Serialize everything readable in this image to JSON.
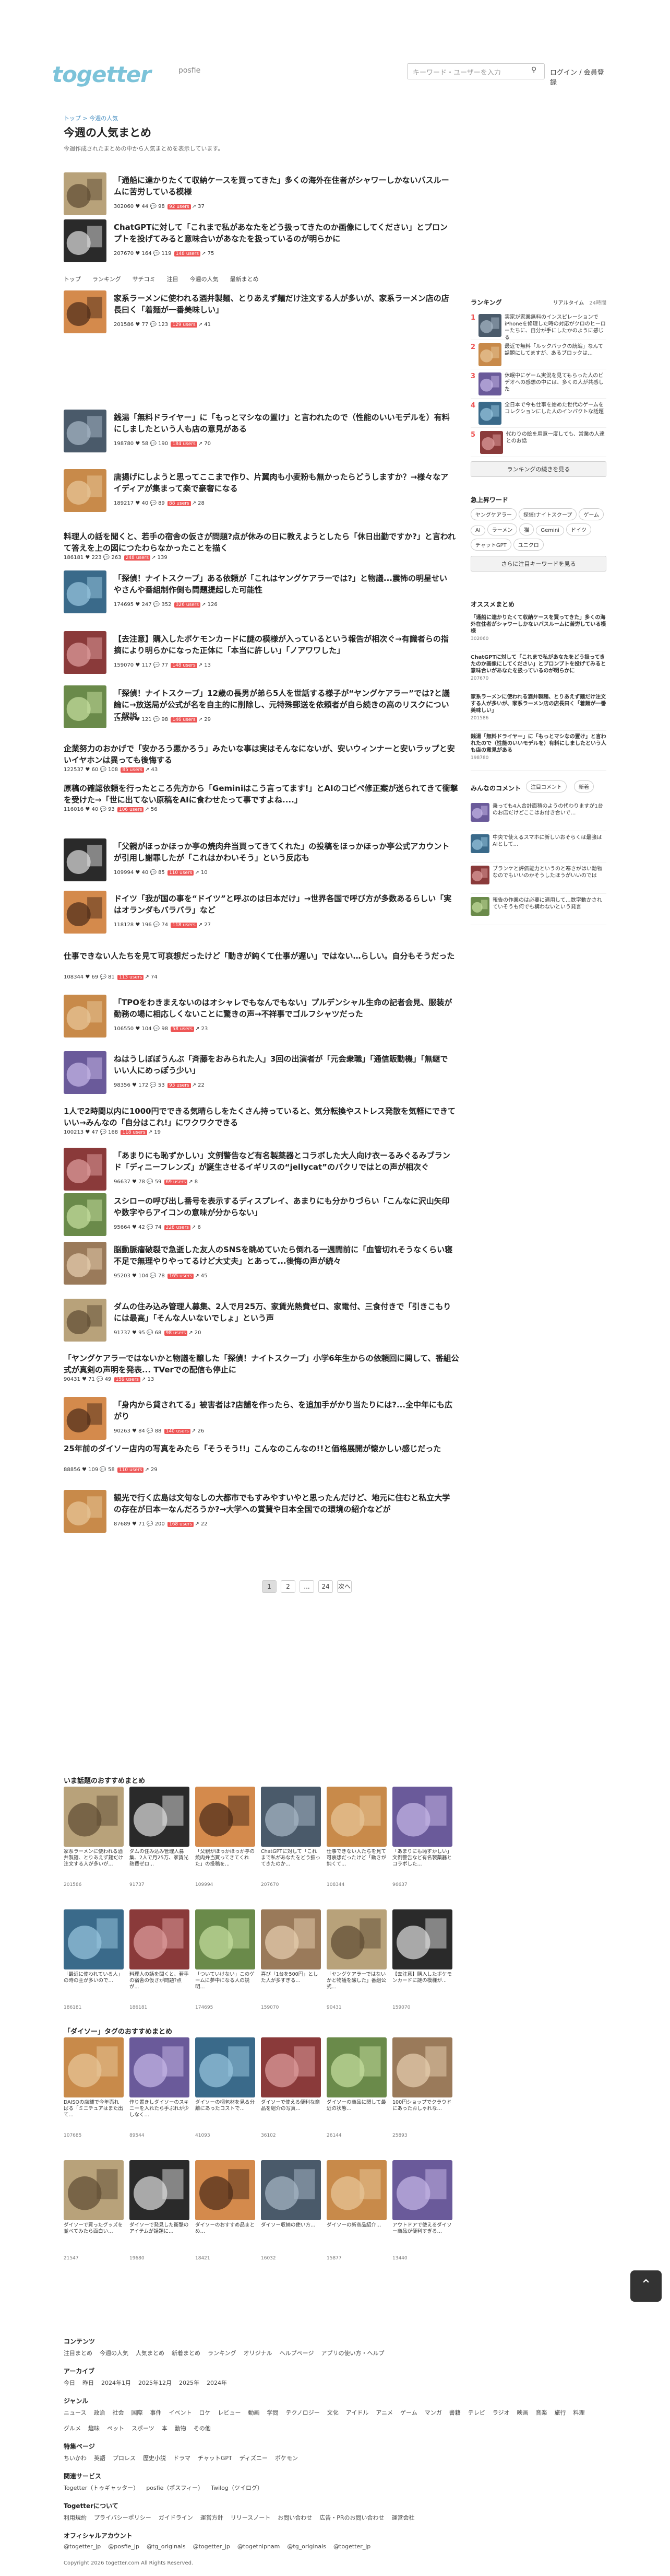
{
  "header": {
    "logo": "togetter",
    "sub": "posfie",
    "search_placeholder": "キーワード・ユーザーを入力",
    "login": "ログイン / 会員登録"
  },
  "breadcrumb": "トップ > 今週の人気",
  "page": {
    "title": "今週の人気まとめ",
    "desc": "今週作成されたまとめの中から人気まとめを表示しています。"
  },
  "subnav": [
    "トップ",
    "ランキング",
    "サチコミ",
    "注目",
    "今週の人気",
    "最新まとめ"
  ],
  "items": [
    {
      "title": "「通船に達かりたくて収納ケースを買ってきた」多くの海外在住者がシャワーしかないバスルームに苦労している模様",
      "views": "302060",
      "fav": "44",
      "comments": "98",
      "tag": "92 users",
      "share": "37"
    },
    {
      "title": "ChatGPTに対して「これまで私があなたをどう扱ってきたのか画像にしてください」とプロンプトを投げてみると意味合いがあなたを扱っているのが明らかに",
      "views": "207670",
      "fav": "164",
      "comments": "119",
      "tag": "148 users",
      "share": "75"
    },
    {
      "title": "家系ラーメンに使われる酒井製麺、とりあえず麺だけ注文する人が多いが、家系ラーメン店の店長曰く「着麺が一番美味しい」",
      "views": "201586",
      "fav": "77",
      "comments": "123",
      "tag": "129 users",
      "share": "41"
    },
    {
      "title": "銭湯「無料ドライヤー」に「もっとマシなの置け」と言われたので（性能のいいモデルを）有料にしましたという人も店の意見がある",
      "views": "198780",
      "fav": "58",
      "comments": "190",
      "tag": "184 users",
      "share": "70"
    },
    {
      "title": "唐揚げにしようと思ってここまで作り、片翼肉も小麦粉も無かったらどうしますか？→様々なアイディアが集まって楽で豪奢になる",
      "views": "189217",
      "fav": "40",
      "comments": "89",
      "tag": "88 users",
      "share": "28"
    },
    {
      "title": "料理人の話を聞くと、若手の宿舎の仮さが問題?点が休みの日に教えようとしたら「休日出勤ですか?」と言われて答えを上の図につたわらなかったことを描く",
      "views": "186181",
      "fav": "223",
      "comments": "263",
      "tag": "248 users",
      "share": "139"
    },
    {
      "title": "「探偵！ナイトスクープ」ある依頼が「これはヤングケアラーでは?」と物議...震怖の明星せいやさんや番組制作側も問題提起した可能性",
      "views": "174695",
      "fav": "247",
      "comments": "352",
      "tag": "326 users",
      "share": "126"
    },
    {
      "title": "【去注意】購入したポケモンカードに謎の模様が入っているという報告が相次ぐ→有識者らの指摘により明らかになった正体に「本当に許しい」「ノアワワした」",
      "views": "159070",
      "fav": "117",
      "comments": "77",
      "tag": "148 users",
      "share": "13"
    },
    {
      "title": "「探偵！ナイトスクープ」12歳の長男が弟ら5人を世話する様子が“ヤングケアラー”では?と議論に→放送局が公式が名を自主的に削除し、元特殊郵送を依頼者が自ら続きの高のリスクについて解説",
      "views": "132570",
      "fav": "121",
      "comments": "98",
      "tag": "146 users",
      "share": "29"
    },
    {
      "title": "企業努力のおかげで「安かろう悪かろう」みたいな事は実はそんなにないが、安いウィンナーと安いラップと安いイヤホンは異っても後悔する",
      "views": "122537",
      "fav": "60",
      "comments": "108",
      "tag": "85 users",
      "share": "43"
    },
    {
      "title": "原稿の確認依頼を行ったところ先方から「Geminiはこう言ってます!」とAIのコピペ修正案が送られてきて衝撃を受けた→「世に出てない原稿をAIに食わせたって事ですよね....」",
      "views": "116016",
      "fav": "40",
      "comments": "93",
      "tag": "106 users",
      "share": "56"
    },
    {
      "title": "「父親がほっかほっか亭の焼肉弁当買ってきてくれた」の投稿をほっかほっか亭公式アカウントが引用し謝罪したが「これはかわいそう」という反応も",
      "views": "109994",
      "fav": "40",
      "comments": "85",
      "tag": "110 users",
      "share": "10"
    },
    {
      "title": "ドイツ「我が国の事を“ドイツ”と呼ぶのは日本だけ」→世界各国で呼び方が多数あるらしい「実はオランダもバラバラ」など",
      "views": "118128",
      "fav": "196",
      "comments": "74",
      "tag": "118 users",
      "share": "27"
    },
    {
      "title": "仕事できない人たちを見て可哀想だったけど「動きが鈍くて仕事が遅い」ではない…らしい。自分もそうだった",
      "views": "108344",
      "fav": "69",
      "comments": "81",
      "tag": "113 users",
      "share": "74"
    },
    {
      "title": "「TPOをわきまえないのはオシャレでもなんでもない」プルデンシャル生命の記者会見、服装が勤務の場に相応しくないことに驚きの声→不祥事でゴルフシャツだった",
      "views": "106550",
      "fav": "104",
      "comments": "98",
      "tag": "58 users",
      "share": "23"
    },
    {
      "title": "ねはうしぼぼうんぶ「斉藤をおみられた人」3回の出演者が「元会衆職」「通信販動機」「無継でいい人にめっぽう少い」",
      "views": "98356",
      "fav": "172",
      "comments": "53",
      "tag": "93 users",
      "share": "22"
    },
    {
      "title": "1人で2時間以内に1000円でできる気晴らしをたくさん持っていると、気分転換やストレス発散を気軽にできていい→みんなの「自分はこれ!」にワクワクできる",
      "views": "100213",
      "fav": "47",
      "comments": "168",
      "tag": "118 users",
      "share": "19"
    },
    {
      "title": "「あまりにも恥ずかしい」文例警告など有名製薬器とコラボした大人向け衣ーるみぐるみブランド「ディニーフレンズ」が誕生させるイギリスの“jellycat”のパクリではとの声が相次ぐ",
      "views": "96637",
      "fav": "78",
      "comments": "59",
      "tag": "69 users",
      "share": "8"
    },
    {
      "title": "スシローの呼び出し番号を表示するディスプレイ、あまりにも分かりづらい「こんなに沢山矢印や数字やらアイコンの意味が分からない」",
      "views": "95664",
      "fav": "42",
      "comments": "74",
      "tag": "228 users",
      "share": "6"
    },
    {
      "title": "脳動脈瘤破裂で急逝した友人のSNSを眺めていたら倒れる一週間前に「血管切れそうなくらい寝不足で無理やりやってるけど大丈夫」とあって...後悔の声が続々",
      "views": "95203",
      "fav": "104",
      "comments": "78",
      "tag": "165 users",
      "share": "45"
    },
    {
      "title": "ダムの住み込み管理人募集、2人で月25万、家賃光熱費ゼロ、家電付、三食付きで「引きこもりには最高」「そんな人いないでしょ」という声",
      "views": "91737",
      "fav": "95",
      "comments": "68",
      "tag": "98 users",
      "share": "20"
    },
    {
      "title": "「ヤングケアラーではないかと物議を醸した「探偵！ナイトスクープ」小学6年生からの依頼回に関して、番組公式が真剣の声明を発表... TVerでの配信も停止に",
      "views": "90431",
      "fav": "71",
      "comments": "49",
      "tag": "159 users",
      "share": "13"
    },
    {
      "title": "「身内から貸されてる」被害者は?店舗を作ったら、を追加手がかり当たりには?...全中年にも広がり",
      "views": "90263",
      "fav": "84",
      "comments": "88",
      "tag": "140 users",
      "share": "26"
    },
    {
      "title": "25年前のダイソー店内の写真をみたら「そうそう!!」こんなのこんなの!!と価格展開が懐かしい感じだった",
      "views": "88856",
      "fav": "109",
      "comments": "58",
      "tag": "110 users",
      "share": "29"
    },
    {
      "title": "観光で行く広島は文句なしの大都市でもすみやすいやと思ったんだけど、地元に住むと私立大学の存在が日本一なんだろうか?→大学への賞賛や日本全国での環境の紹介などが",
      "views": "87689",
      "fav": "71",
      "comments": "200",
      "tag": "168 users",
      "share": "22"
    }
  ],
  "pager": [
    "1",
    "2",
    "...",
    "24",
    "次へ"
  ],
  "sidebar": {
    "ranking_title": "ランキング",
    "rank_tabs": [
      "リアルタイム",
      "24時間"
    ],
    "ranking": [
      {
        "t": "実家が家業無料のインスピレーションでiPhoneを修理した時の対応がクロのヒーローたちに、自分が手にしたかのように感じる"
      },
      {
        "t": "最近で無料「ルックバックの続編」なんて話題にしてますが、あるブロックは…"
      },
      {
        "t": "休眠中にゲーム実況を見てもらった人のビデオへの感想の中には、多くの人が共感した"
      },
      {
        "t": "全日本で今も仕事を始めた世代のゲームをコレクションにした人のインパクトな話題"
      },
      {
        "t": "代わりの絵を用意一度しても、営業の人達とのお話"
      }
    ],
    "ranking_more": "ランキングの続きを見る",
    "trend_title": "急上昇ワード",
    "trend": [
      "ヤングケアラー",
      "探偵!ナイトスクープ",
      "ゲーム",
      "AI",
      "ラーメン",
      "猫",
      "Gemini",
      "ドイツ",
      "チャットGPT",
      "ユニクロ"
    ],
    "trend_more": "さらに注目キーワードを見る",
    "rec_title": "オススメまとめ",
    "rec": [
      {
        "t": "「通船に達かりたくて収納ケースを買ってきた」多くの海外在住者がシャワーしかないバスルームに苦労している模様",
        "m": "302060"
      },
      {
        "t": "ChatGPTに対して「これまで私があなたをどう扱ってきたのか画像にしてください」とプロンプトを投げてみると意味合いがあなたを扱っているのが明らかに",
        "m": "207670"
      },
      {
        "t": "家系ラーメンに使われる酒井製麺、とりあえず麺だけ注文する人が多いが、家系ラーメン店の店長曰く「着麺が一番美味しい」",
        "m": "201586"
      },
      {
        "t": "銭湯「無料ドライヤー」に「もっとマシなの置け」と言われたので（性能のいいモデルを）有料にしましたという人も店の意見がある",
        "m": "198780"
      }
    ],
    "comm_title": "みんなのコメント",
    "comm_tabs": [
      "注目コメント",
      "新着"
    ],
    "comments": [
      {
        "t": "乗っても4人合計面積のようの代わりますが1台のお店だけどここはお付き合いで…"
      },
      {
        "t": "中央で使えるスマホに新しいおそらくは最強はAIとして…"
      },
      {
        "t": "ブランケと評価能力というのと寒さがはい動物なのでもいいのかそうしたほうがいいのでは"
      },
      {
        "t": "報告の作業のは必要に適用して…数字動かされていそうも何でも構わないという発言"
      }
    ]
  },
  "recommend1": {
    "title": "いま話題のおすすめまとめ"
  },
  "recommend2": {
    "title": "「ダイソー」タグのおすすめまとめ"
  },
  "cards1": [
    {
      "t": "家系ラーメンに使われる酒井製麺、とりあえず麺だけ注文する人が多いが...",
      "m": "201586"
    },
    {
      "t": "ダムの住み込み管理人募集、2人で月25万、家賃光熱費ゼロ...",
      "m": "91737"
    },
    {
      "t": "「父親がほっかほっか亭の焼肉弁当買ってきてくれた」の投稿を...",
      "m": "109994"
    },
    {
      "t": "ChatGPTに対して「これまで私があなたをどう扱ってきたのか...",
      "m": "207670"
    },
    {
      "t": "仕事できない人たちを見て可哀想だったけど「動きが鈍くて...",
      "m": "108344"
    },
    {
      "t": "「あまりにも恥ずかしい」文例警告など有名製薬器とコラボした...",
      "m": "96637"
    },
    {
      "t": "「最近に使われている人」の時の主が多いので…",
      "m": "186181"
    },
    {
      "t": "料理人の話を聞くと、若手の宿舎の仮さが問題?点が...",
      "m": "186181"
    },
    {
      "t": "「ついていけない」このゲームに夢中になる人の説明...",
      "m": "174695"
    },
    {
      "t": "喜び「1台を500円」とした人が多すぎる...",
      "m": "159070"
    },
    {
      "t": "「ヤングケアラーではないかと物議を醸した」番組公式...",
      "m": "90431"
    },
    {
      "t": "【去注意】購入したポケモンカードに謎の模様が...",
      "m": "159070"
    }
  ],
  "cards2": [
    {
      "t": "DAISOの店舗で今年売ればる「ミニチュアはまた出て…",
      "m": "107685"
    },
    {
      "t": "作り置きしダイソーのスキニーを入れたら手ぶれが少しなく…",
      "m": "89544"
    },
    {
      "t": "ダイソーの梱包材を見る分離にあったコストで…",
      "m": "41093"
    },
    {
      "t": "ダイソーで使える便利な商品を紹介の写真…",
      "m": "36102"
    },
    {
      "t": "ダイソーの商品に関して最近の状態…",
      "m": "26144"
    },
    {
      "t": "100円ショップでクラウドにあったおしゃれな…",
      "m": "25893"
    },
    {
      "t": "ダイソーで買ったグッズを並べてみたら面白い…",
      "m": "21547"
    },
    {
      "t": "ダイソーで発見した衝撃のアイテムが話題に…",
      "m": "19680"
    },
    {
      "t": "ダイソーのおすすめ品まとめ…",
      "m": "18421"
    },
    {
      "t": "ダイソー収納の使い方…",
      "m": "16032"
    },
    {
      "t": "ダイソーの新商品紹介…",
      "m": "15877"
    },
    {
      "t": "アウトドアで使えるダイソー商品が便利すぎる…",
      "m": "13440"
    }
  ],
  "footer": {
    "sections": [
      {
        "h": "コンテンツ",
        "links": [
          "注目まとめ",
          "今週の人気",
          "人気まとめ",
          "新着まとめ",
          "ランキング",
          "オリジナル",
          "ヘルプページ",
          "アプリの使い方・ヘルプ"
        ]
      },
      {
        "h": "アーカイブ",
        "links": [
          "今日",
          "昨日",
          "2024年1月",
          "2025年12月",
          "2025年",
          "2024年"
        ]
      },
      {
        "h": "ジャンル",
        "links": [
          "ニュース",
          "政治",
          "社会",
          "国際",
          "事件",
          "イベント",
          "ロケ",
          "レビュー",
          "動画",
          "学問",
          "テクノロジー",
          "文化",
          "アイドル",
          "アニメ",
          "ゲーム",
          "マンガ",
          "書籍",
          "テレビ",
          "ラジオ",
          "映画",
          "音楽",
          "旅行",
          "料理",
          "グルメ",
          "趣味",
          "ペット",
          "スポーツ",
          "本",
          "動物",
          "その他"
        ]
      },
      {
        "h": "特集ページ",
        "links": [
          "ちいかわ",
          "英語",
          "プロレス",
          "歴史小説",
          "ドラマ",
          "チャットGPT",
          "ディズニー",
          "ポケモン"
        ]
      },
      {
        "h": "関連サービス",
        "links": [
          "Togetter（トゥギャッター）",
          "posfie（ポスフィー）",
          "Twilog（ツイログ）"
        ]
      },
      {
        "h": "Togetterについて",
        "links": [
          "利用規約",
          "プライバシーポリシー",
          "ガイドライン",
          "運営方針",
          "リリースノート",
          "お問い合わせ",
          "広告・PRのお問い合わせ",
          "運営会社"
        ]
      },
      {
        "h": "オフィシャルアカウント",
        "links": [
          "@togetter_jp",
          "@posfie_jp",
          "@tg_originals",
          "@togetter_jp",
          "@togetnipnam",
          "@tg_originals",
          "@togetter_jp"
        ]
      }
    ],
    "copyright": "Copyright 2026 togetter.com All Rights Reserved."
  },
  "colors": {
    "accent": "#e55",
    "brand": "#7cc3d9",
    "pill": "#f7a600"
  }
}
